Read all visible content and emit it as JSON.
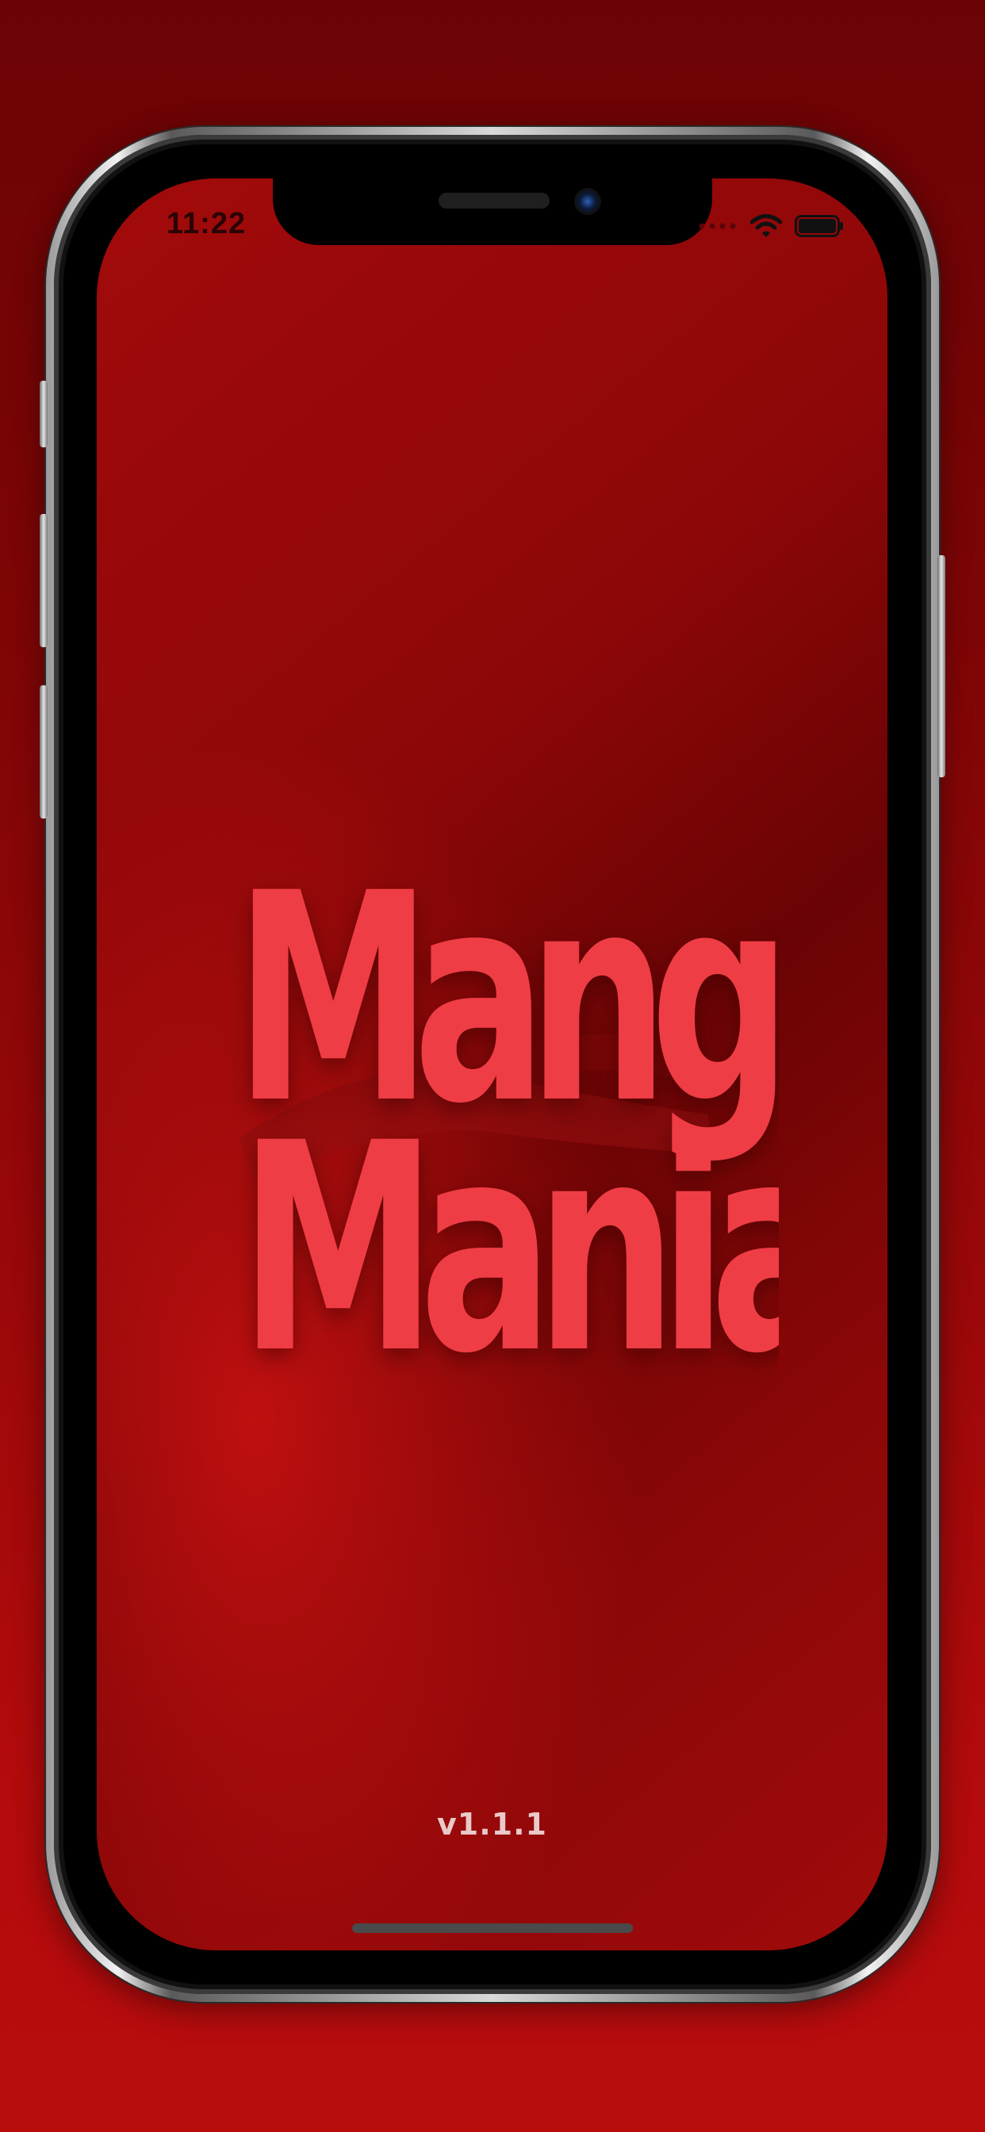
{
  "status_bar": {
    "time": "11:22",
    "icons": [
      "cellular-signal-icon",
      "wifi-icon",
      "battery-icon"
    ]
  },
  "splash": {
    "logo": {
      "lines": [
        "Manga",
        "Mania"
      ],
      "color": "#ef3e45"
    },
    "version": "v1.1.1"
  },
  "colors": {
    "background": "#7a0506",
    "screen": "#8e0708",
    "logo_text": "#ef3e45",
    "version_text": "#e9c9c9"
  }
}
